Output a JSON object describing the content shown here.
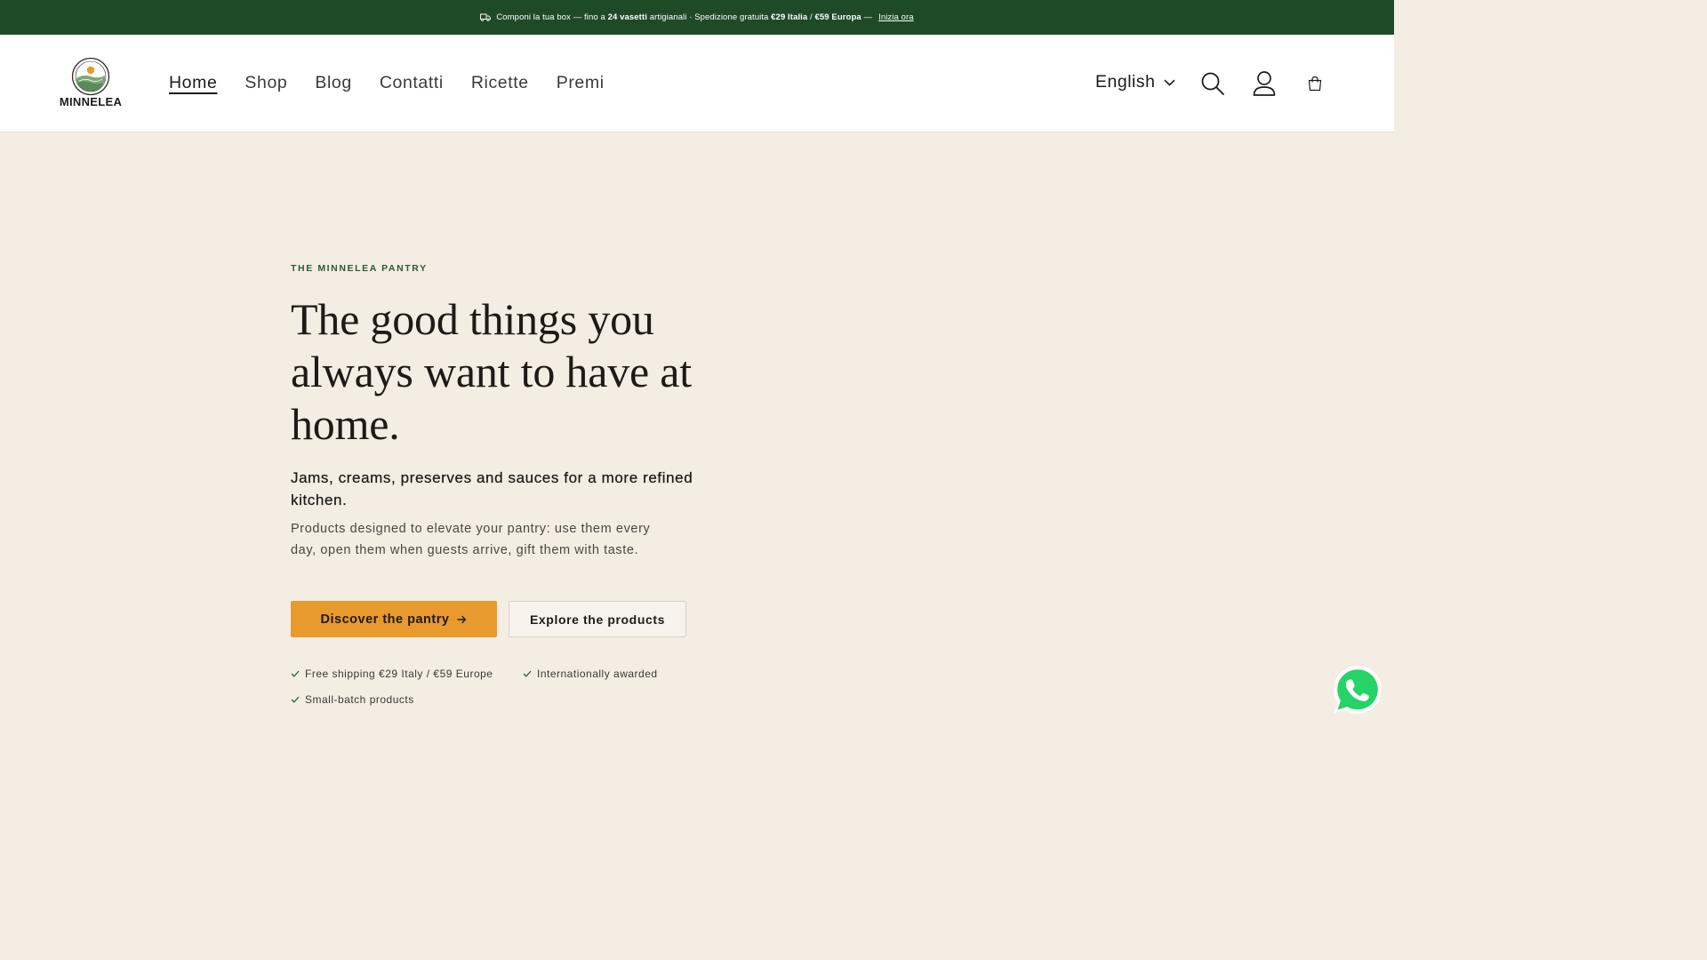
{
  "announcement": {
    "text_start": "Componi la tua box — fino a ",
    "bold_jars": "24 vasetti",
    "text_mid": " artigianali · Spedizione gratuita ",
    "bold_italy": "€29 Italia",
    "text_sep": " / ",
    "bold_europe": "€59 Europa",
    "text_end": " —",
    "link": "Inizia ora"
  },
  "header": {
    "logo_text": "MINNELEA",
    "nav": [
      {
        "label": "Home",
        "active": true
      },
      {
        "label": "Shop"
      },
      {
        "label": "Blog"
      },
      {
        "label": "Contatti"
      },
      {
        "label": "Ricette"
      },
      {
        "label": "Premi"
      }
    ],
    "language": "English",
    "icons": [
      "search-icon",
      "account-icon",
      "cart-icon"
    ]
  },
  "hero": {
    "eyebrow": "THE MINNELEA PANTRY",
    "headline": "The good things you always want to have at home.",
    "subheadline": "Jams, creams, preserves and sauces for a more refined kitchen.",
    "body": "Products designed to elevate your pantry: use them every day, open them when guests arrive, gift them with taste.",
    "primary_cta": "Discover the pantry",
    "secondary_cta": "Explore the products",
    "features": [
      "Free shipping €29 Italy / €59 Europe",
      "Internationally awarded",
      "Small-batch products"
    ]
  },
  "colors": {
    "announcement_bg": "#1f4a28",
    "hero_bg": "#f4ede4",
    "accent": "#e99a2c",
    "eyebrow": "#2d5a33",
    "whatsapp": "#25d366"
  }
}
